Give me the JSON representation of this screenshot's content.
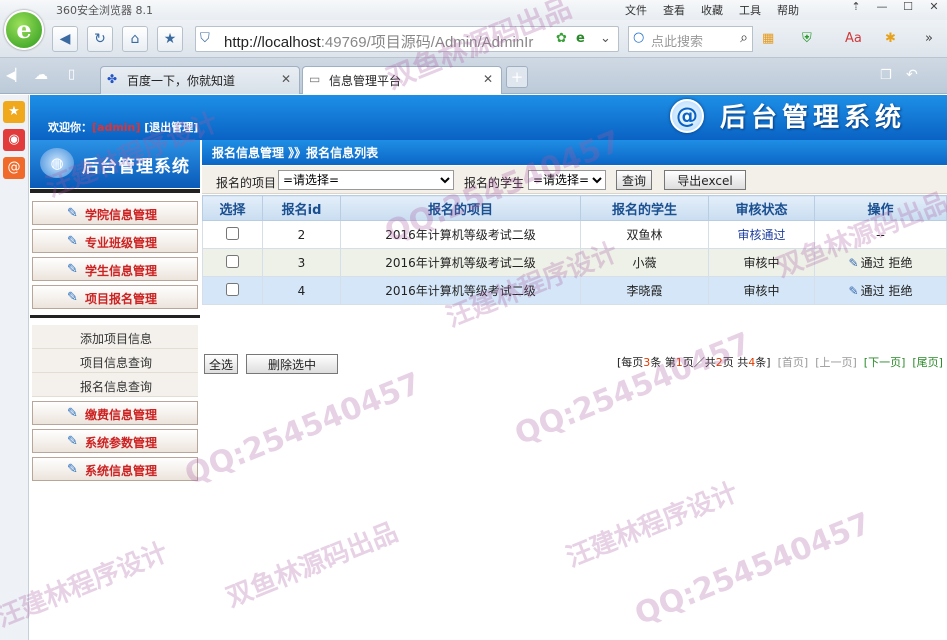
{
  "browser": {
    "app_title": "360安全浏览器 8.1",
    "menus": [
      "文件",
      "查看",
      "收藏",
      "工具",
      "帮助"
    ],
    "url_host": "http://localhost",
    "url_rest": ":49769/项目源码/Admin/AdminIr",
    "search_placeholder": "点此搜索",
    "tabs": [
      {
        "label": "百度一下，你就知道",
        "active": false
      },
      {
        "label": "信息管理平台",
        "active": true
      }
    ]
  },
  "header": {
    "welcome_label": "欢迎你：",
    "user": "[admin]",
    "logout": "[退出管理]",
    "system_title": "后台管理系统",
    "at_symbol": "@"
  },
  "sidebar": {
    "system_name": "后台管理系统",
    "menus_top": [
      "学院信息管理",
      "专业班级管理",
      "学生信息管理",
      "项目报名管理"
    ],
    "submenu": [
      "添加项目信息",
      "项目信息查询",
      "报名信息查询"
    ],
    "menus_bottom": [
      "缴费信息管理",
      "系统参数管理",
      "系统信息管理"
    ]
  },
  "breadcrumb": "报名信息管理 》》报名信息列表",
  "filter": {
    "project_label": "报名的项目",
    "project_value": "=请选择=",
    "student_label": "报名的学生",
    "student_value": "=请选择=",
    "query_button": "查询",
    "export_button": "导出excel"
  },
  "table": {
    "headers": [
      "选择",
      "报名id",
      "报名的项目",
      "报名的学生",
      "审核状态",
      "操作"
    ],
    "rows": [
      {
        "id": "2",
        "project": "2016年计算机等级考试二级",
        "student": "双鱼林",
        "status": "审核通过",
        "action": "--"
      },
      {
        "id": "3",
        "project": "2016年计算机等级考试二级",
        "student": "小薇",
        "status": "审核中",
        "approve": "通过",
        "reject": "拒绝"
      },
      {
        "id": "4",
        "project": "2016年计算机等级考试二级",
        "student": "李晓霞",
        "status": "审核中",
        "approve": "通过",
        "reject": "拒绝"
      }
    ]
  },
  "actions": {
    "select_all": "全选",
    "delete_selected": "删除选中"
  },
  "pager": {
    "per_page_prefix": "[每页",
    "per_page": "3",
    "per_page_suffix": "条 第",
    "current": "1",
    "mid": "页／共",
    "total_pages": "2",
    "mid2": "页 共",
    "total": "4",
    "end": "条]",
    "first": "[首页]",
    "prev": "[上一页]",
    "next": "[下一页]",
    "last": "[尾页]"
  },
  "watermarks": [
    "QQ:254540457",
    "双鱼林源码出品",
    "汪建林程序设计"
  ]
}
